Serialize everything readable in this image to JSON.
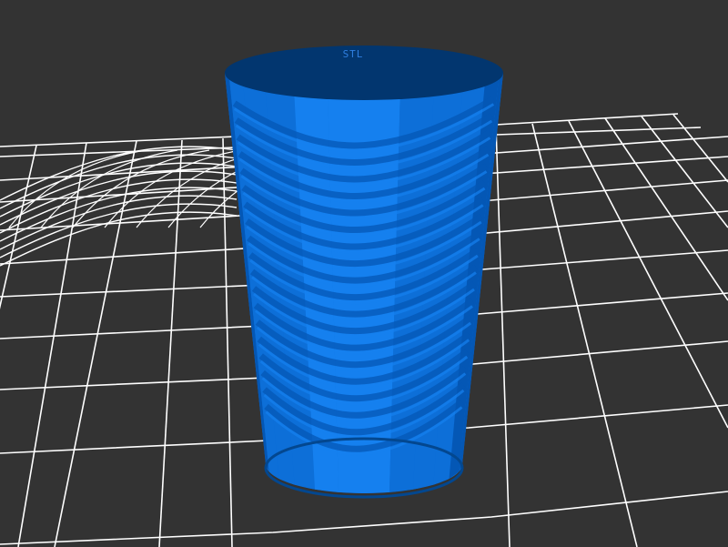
{
  "viewport": {
    "background_color": "#333333",
    "grid_color": "#ffffff"
  },
  "model": {
    "shape": "cylinder",
    "top_label": "STL",
    "colors": {
      "top_face": "#02366f",
      "body_light": "#1580ef",
      "body_mid": "#0d6fd8",
      "body_dark": "#0457b5",
      "edge_shadow": "#03478f"
    }
  }
}
